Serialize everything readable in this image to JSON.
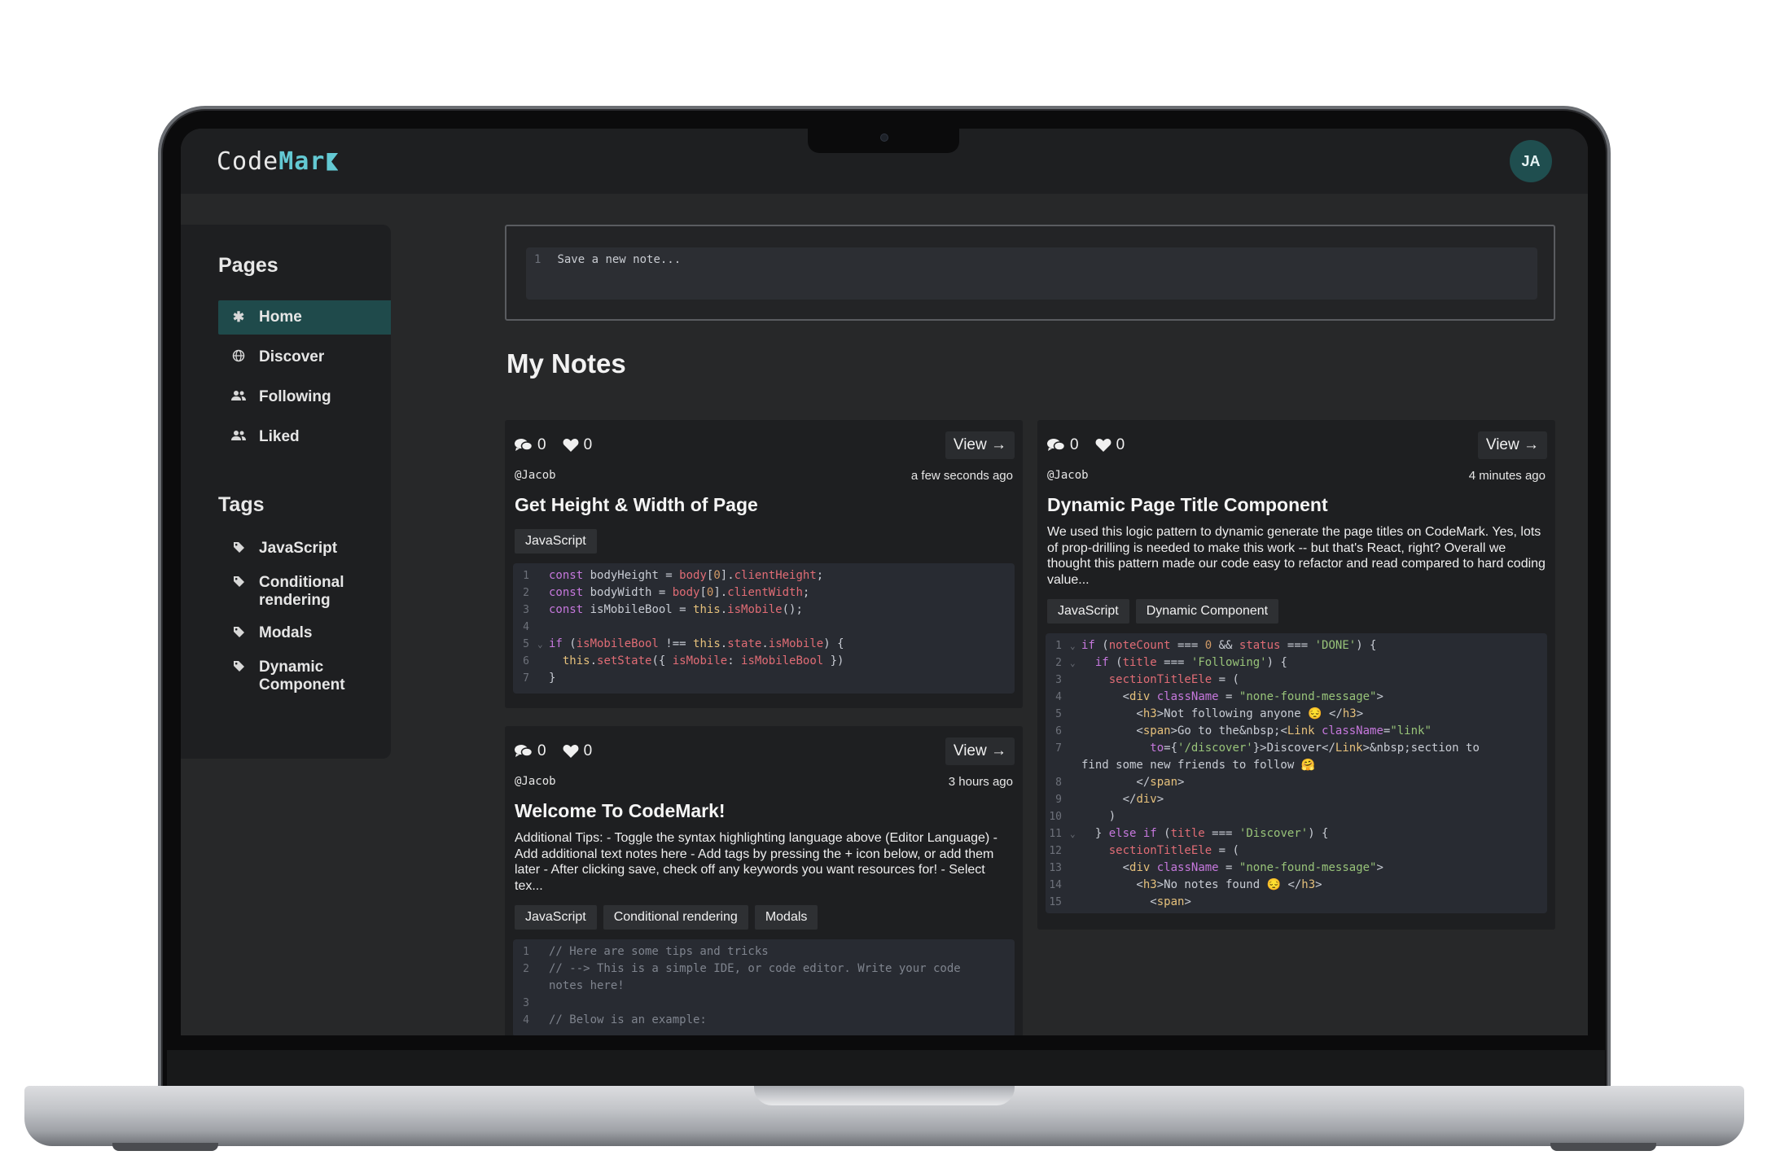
{
  "app": {
    "logo_main": "Code",
    "logo_accent": "Mar",
    "avatar_initials": "JA"
  },
  "sidebar": {
    "pages_title": "Pages",
    "pages": [
      {
        "label": "Home",
        "icon": "asterisk-icon",
        "active": true
      },
      {
        "label": "Discover",
        "icon": "globe-icon",
        "active": false
      },
      {
        "label": "Following",
        "icon": "users-icon",
        "active": false
      },
      {
        "label": "Liked",
        "icon": "users-icon",
        "active": false
      }
    ],
    "tags_title": "Tags",
    "tags": [
      "JavaScript",
      "Conditional rendering",
      "Modals",
      "Dynamic Component"
    ]
  },
  "composer": {
    "line_number": "1",
    "placeholder": "Save a new note..."
  },
  "main": {
    "title": "My Notes"
  },
  "notes": [
    {
      "comments": "0",
      "likes": "0",
      "view_label": "View",
      "author": "@Jacob",
      "time": "a few seconds ago",
      "title": "Get Height & Width of Page",
      "tags": [
        "JavaScript"
      ]
    },
    {
      "comments": "0",
      "likes": "0",
      "view_label": "View",
      "author": "@Jacob",
      "time": "3 hours ago",
      "title": "Welcome To CodeMark!",
      "description": "Additional Tips: - Toggle the syntax highlighting language above (Editor Language) - Add additional text notes here - Add tags by pressing the + icon below, or add them later - After clicking save, check off any keywords you want resources for! - Select tex...",
      "tags": [
        "JavaScript",
        "Conditional rendering",
        "Modals"
      ]
    },
    {
      "comments": "0",
      "likes": "0",
      "view_label": "View",
      "author": "@Jacob",
      "time": "4 minutes ago",
      "title": "Dynamic Page Title Component",
      "description": "We used this logic pattern to dynamic generate the page titles on CodeMark. Yes, lots of prop-drilling is needed to make this work -- but that's React, right? Overall we thought this pattern made our code easy to refactor and read compared to hard coding value...",
      "tags": [
        "JavaScript",
        "Dynamic Component"
      ]
    }
  ],
  "code_snippets": {
    "note1": [
      "const bodyHeight = body[0].clientHeight;",
      "const bodyWidth = body[0].clientWidth;",
      "const isMobileBool = this.isMobile();",
      "",
      "if (isMobileBool !== this.state.isMobile) {",
      "  this.setState({ isMobile: isMobileBool })",
      "}"
    ],
    "note2": [
      "// Here are some tips and tricks",
      "// --> This is a simple IDE, or code editor. Write your code",
      "notes here!",
      "",
      "// Below is an example:"
    ],
    "note3": [
      "if (noteCount === 0 && status === 'DONE') {",
      "  if (title === 'Following') {",
      "    sectionTitleEle = (",
      "      <div className = \"none-found-message\">",
      "        <h3>Not following anyone 😔 </h3>",
      "        <span>Go to the&nbsp;<Link className=\"link\"",
      "          to={'/discover'}>Discover</Link>&nbsp;section to",
      "find some new friends to follow 🤗",
      "        </span>",
      "      </div>",
      "    )",
      "  } else if (title === 'Discover') {",
      "    sectionTitleEle = (",
      "      <div className = \"none-found-message\">",
      "        <h3>No notes found 😔 </h3>",
      "          <span>"
    ]
  }
}
